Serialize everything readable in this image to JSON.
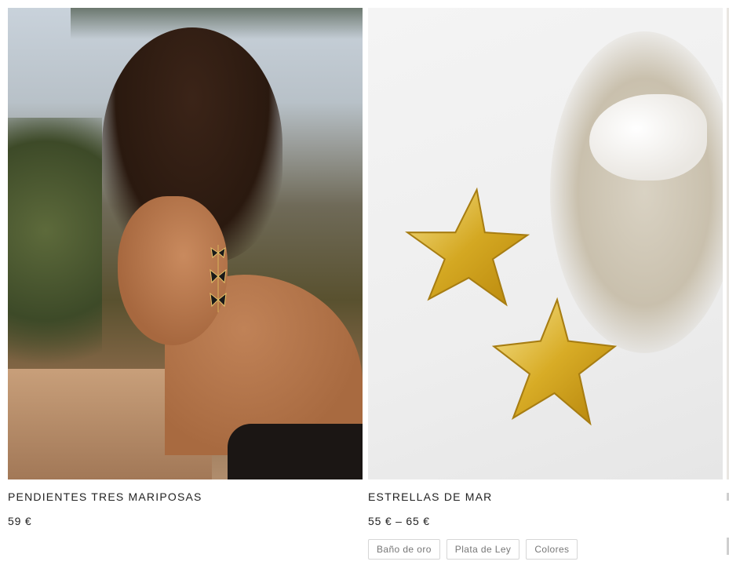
{
  "products": [
    {
      "title": "PENDIENTES TRES MARIPOSAS",
      "price": "59 €",
      "image": "woman-wearing-butterfly-earrings",
      "variants": []
    },
    {
      "title": "ESTRELLAS DE MAR",
      "price": "55 € – 65 €",
      "image": "gold-starfish-earrings",
      "variants": [
        "Baño de oro",
        "Plata de Ley",
        "Colores"
      ]
    }
  ]
}
